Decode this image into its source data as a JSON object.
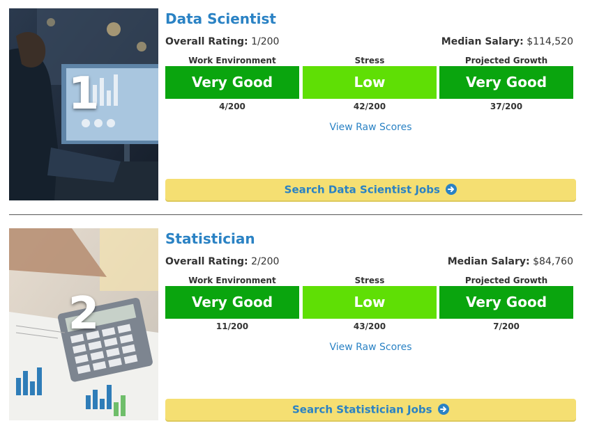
{
  "jobs": [
    {
      "rank": "1",
      "title": "Data Scientist",
      "overall_label": "Overall Rating:",
      "overall_value": "1/200",
      "salary_label": "Median Salary:",
      "salary_value": "$114,520",
      "metrics": [
        {
          "label": "Work Environment",
          "value": "Very Good",
          "score": "4/200",
          "color": "#0aa50e"
        },
        {
          "label": "Stress",
          "value": "Low",
          "score": "42/200",
          "color": "#5fdf05"
        },
        {
          "label": "Projected Growth",
          "value": "Very Good",
          "score": "37/200",
          "color": "#0aa50e"
        }
      ],
      "raw_scores_link": "View Raw Scores",
      "search_button": "Search Data Scientist Jobs"
    },
    {
      "rank": "2",
      "title": "Statistician",
      "overall_label": "Overall Rating:",
      "overall_value": "2/200",
      "salary_label": "Median Salary:",
      "salary_value": "$84,760",
      "metrics": [
        {
          "label": "Work Environment",
          "value": "Very Good",
          "score": "11/200",
          "color": "#0aa50e"
        },
        {
          "label": "Stress",
          "value": "Low",
          "score": "43/200",
          "color": "#5fdf05"
        },
        {
          "label": "Projected Growth",
          "value": "Very Good",
          "score": "7/200",
          "color": "#0aa50e"
        }
      ],
      "raw_scores_link": "View Raw Scores",
      "search_button": "Search Statistician Jobs"
    }
  ],
  "colors": {
    "link": "#2a82c4",
    "button_bg": "#f5df72",
    "very_good": "#0aa50e",
    "low": "#5fdf05"
  },
  "icons": {
    "search_arrow": "arrow-circle-right-icon"
  }
}
